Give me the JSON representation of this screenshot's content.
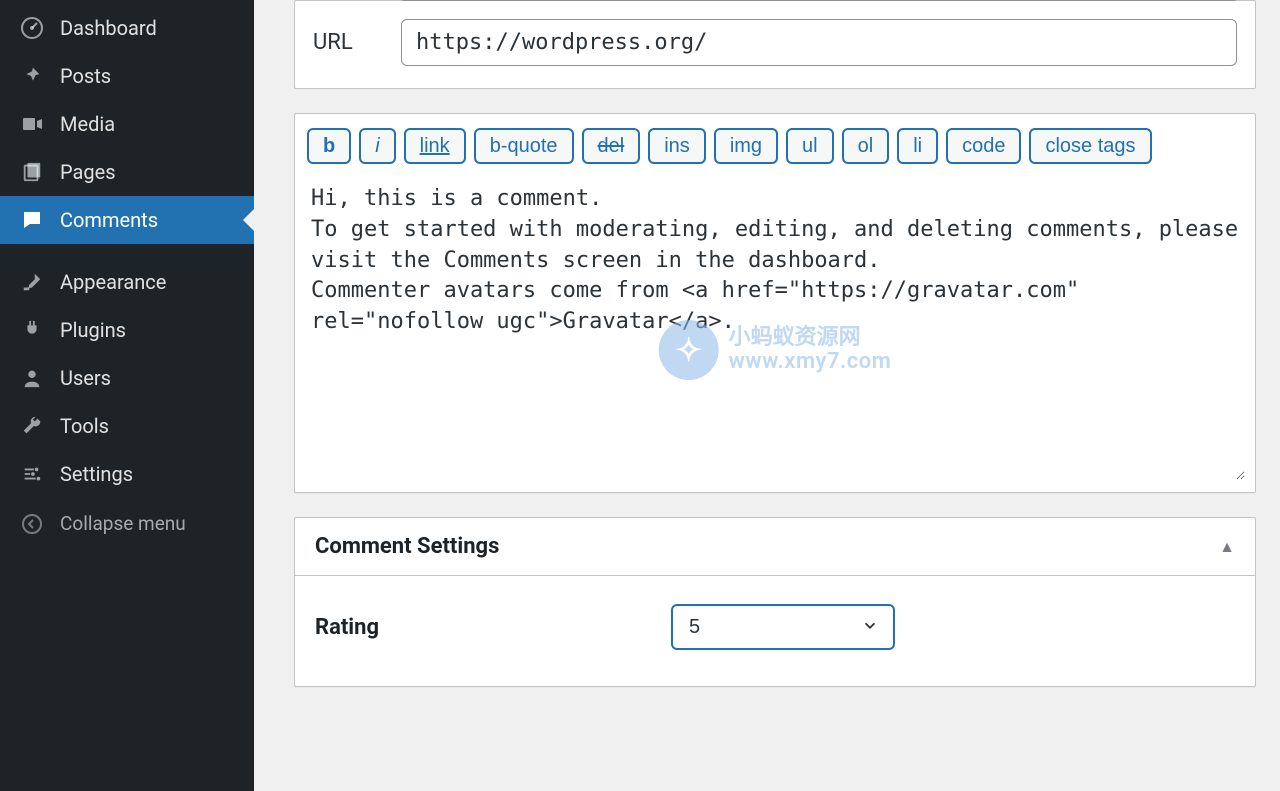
{
  "sidebar": {
    "items": [
      {
        "id": "dashboard",
        "label": "Dashboard",
        "icon": "dashboard-icon"
      },
      {
        "id": "posts",
        "label": "Posts",
        "icon": "pin-icon"
      },
      {
        "id": "media",
        "label": "Media",
        "icon": "media-icon"
      },
      {
        "id": "pages",
        "label": "Pages",
        "icon": "page-icon"
      },
      {
        "id": "comments",
        "label": "Comments",
        "icon": "comment-icon",
        "active": true
      },
      {
        "id": "appearance",
        "label": "Appearance",
        "icon": "brush-icon"
      },
      {
        "id": "plugins",
        "label": "Plugins",
        "icon": "plug-icon"
      },
      {
        "id": "users",
        "label": "Users",
        "icon": "user-icon"
      },
      {
        "id": "tools",
        "label": "Tools",
        "icon": "wrench-icon"
      },
      {
        "id": "settings",
        "label": "Settings",
        "icon": "sliders-icon"
      }
    ],
    "collapse_label": "Collapse menu"
  },
  "url_field": {
    "label": "URL",
    "value": "https://wordpress.org/"
  },
  "quicktags": [
    {
      "id": "b",
      "label": "b",
      "style": "bold"
    },
    {
      "id": "i",
      "label": "i",
      "style": "italic"
    },
    {
      "id": "link",
      "label": "link",
      "style": "link"
    },
    {
      "id": "bquote",
      "label": "b-quote",
      "style": ""
    },
    {
      "id": "del",
      "label": "del",
      "style": "strike"
    },
    {
      "id": "ins",
      "label": "ins",
      "style": ""
    },
    {
      "id": "img",
      "label": "img",
      "style": ""
    },
    {
      "id": "ul",
      "label": "ul",
      "style": ""
    },
    {
      "id": "ol",
      "label": "ol",
      "style": ""
    },
    {
      "id": "li",
      "label": "li",
      "style": ""
    },
    {
      "id": "code",
      "label": "code",
      "style": ""
    },
    {
      "id": "close",
      "label": "close tags",
      "style": ""
    }
  ],
  "editor_content": "Hi, this is a comment.\nTo get started with moderating, editing, and deleting comments, please visit the Comments screen in the dashboard.\nCommenter avatars come from <a href=\"https://gravatar.com\" rel=\"nofollow ugc\">Gravatar</a>.",
  "watermark": {
    "title": "小蚂蚁资源网",
    "url": "www.xmy7.com"
  },
  "comment_settings": {
    "header": "Comment Settings",
    "rating_label": "Rating",
    "rating_value": "5"
  }
}
